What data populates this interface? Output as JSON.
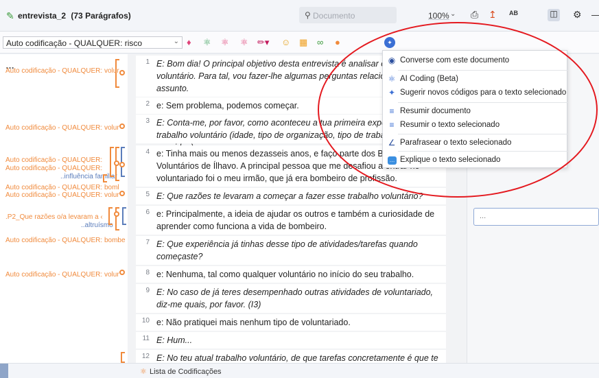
{
  "header": {
    "title": "entrevista_2",
    "paragraph_count": "(73 Parágrafos)",
    "search_placeholder": "Documento",
    "zoom": "100%",
    "spell_label": "AB"
  },
  "codebar": {
    "selected_code": "Auto codificação - QUALQUER: risco"
  },
  "margin": {
    "labels": [
      "Auto codificação - QUALQUER: volur",
      "Auto codificação - QUALQUER: volur",
      "Auto codificação - QUALQUER:",
      "Auto codificação - QUALQUER:",
      "..influência familiar",
      "Auto codificação - QUALQUER: boml",
      "Auto codificação - QUALQUER: volur",
      ".P2_Que razões o/a levaram a ‹",
      "..altruísmo",
      "Auto codificação - QUALQUER: bombe",
      "Auto codificação - QUALQUER: volur"
    ]
  },
  "paragraphs": [
    {
      "num": "1",
      "text": "E: Bom dia! O principal objetivo desta entrevista é analisar o trabalho voluntário. Para tal, vou fazer-lhe algumas perguntas relacionadas com o assunto."
    },
    {
      "num": "2",
      "text": "e: Sem problema, podemos começar."
    },
    {
      "num": "3",
      "text": "E: Conta-me, por favor, como aconteceu a tua primeira experiência de trabalho voluntário (idade, tipo de organização, tipo de trabalho, quem te convidou)."
    },
    {
      "num": "4",
      "text": "e: Tinha mais ou menos dezasseis anos, e faço parte dos Bombeiros Voluntários de Ílhavo. A principal pessoa que me desafiou a entrar no voluntariado foi o meu irmão, que já era bombeiro de profissão."
    },
    {
      "num": "5",
      "text": "E: Que razões te levaram a começar a fazer esse trabalho voluntário?"
    },
    {
      "num": "6",
      "text": "e: Principalmente, a ideia de ajudar os outros e também a curiosidade de aprender como funciona a vida de bombeiro."
    },
    {
      "num": "7",
      "text": "E: Que experiência já tinhas desse tipo de atividades/tarefas quando começaste?"
    },
    {
      "num": "8",
      "text": "e: Nenhuma, tal como qualquer voluntário no início do seu trabalho."
    },
    {
      "num": "9",
      "text": "E: No caso de já teres desempenhado outras atividades de voluntariado, diz-me quais, por favor. (I3)"
    },
    {
      "num": "10",
      "text": "e: Não pratiquei mais nenhum tipo de voluntariado."
    },
    {
      "num": "11",
      "text": "E: Hum..."
    },
    {
      "num": "12",
      "text": "E: No teu atual trabalho voluntário, de que tarefas concretamente é que te"
    }
  ],
  "menu": {
    "items": [
      {
        "label": "Converse com este documento",
        "icon": "chat-bubble-icon"
      },
      {
        "label": "AI Coding (Beta)",
        "icon": "ai-coding-icon"
      },
      {
        "label": "Sugerir novos códigos para o texto selecionado",
        "icon": "sparkle-icon"
      },
      {
        "label": "Resumir documento",
        "icon": "summary-icon"
      },
      {
        "label": "Resumir o texto selecionado",
        "icon": "summary-selection-icon"
      },
      {
        "label": "Parafrasear o texto selecionado",
        "icon": "paraphrase-icon"
      },
      {
        "label": "Explique o texto selecionado",
        "icon": "explain-icon"
      }
    ]
  },
  "right_pane": {
    "comment_value": "..."
  },
  "bottom": {
    "tab_label": "Lista de Codificações"
  },
  "colors": {
    "code_orange": "#f08a3c",
    "highlight_red": "#e4191f",
    "accent_blue": "#3b6fd4"
  }
}
